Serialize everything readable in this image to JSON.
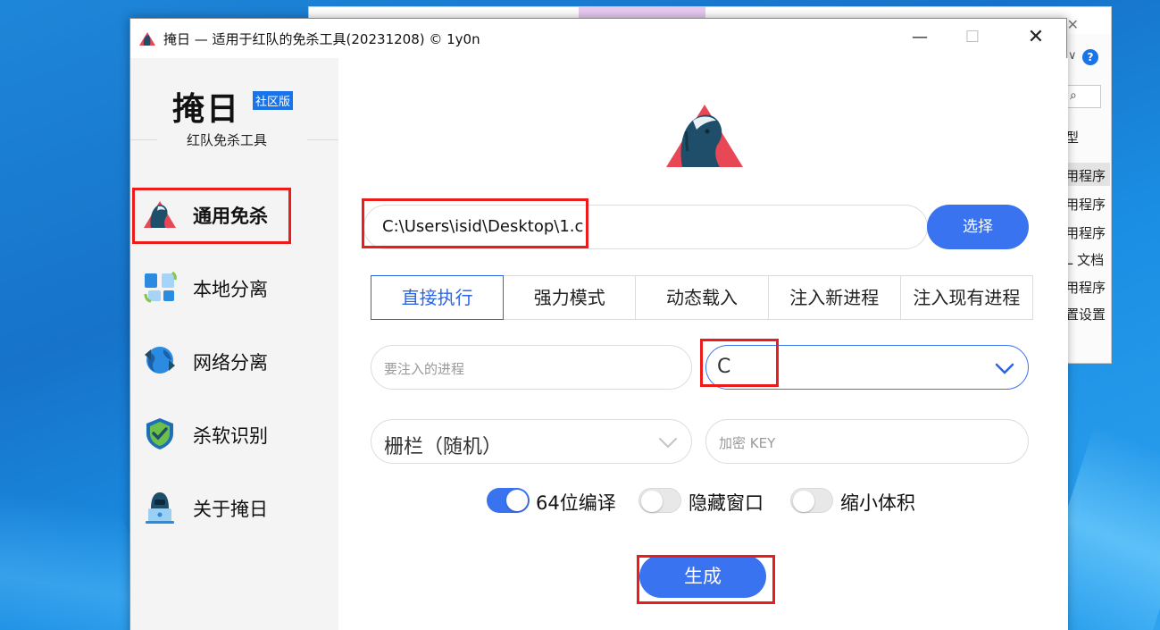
{
  "window": {
    "title": "掩日 — 适用于红队的免杀工具(20231208) © 1y0n",
    "minimize": "—",
    "maximize": "☐",
    "close": "✕"
  },
  "background_window": {
    "items": [
      "用程序",
      "用程序",
      "用程序",
      "L 文档",
      "用程序",
      "置设置"
    ],
    "header_fragment": "型",
    "close": "✕",
    "help": "?",
    "chevron": "∨",
    "search_icon": "⌕"
  },
  "sidebar": {
    "logo_title": "掩日",
    "logo_badge": "社区版",
    "logo_subtitle": "红队免杀工具",
    "items": [
      {
        "label": "通用免杀",
        "icon": "horse-icon",
        "active": true
      },
      {
        "label": "本地分离",
        "icon": "file-split-icon",
        "active": false
      },
      {
        "label": "网络分离",
        "icon": "globe-arrows-icon",
        "active": false
      },
      {
        "label": "杀软识别",
        "icon": "shield-check-icon",
        "active": false
      },
      {
        "label": "关于掩日",
        "icon": "hacker-laptop-icon",
        "active": false
      }
    ]
  },
  "main": {
    "file_path": "C:\\Users\\isid\\Desktop\\1.c",
    "select_button": "选择",
    "tabs": [
      {
        "label": "直接执行",
        "active": true
      },
      {
        "label": "强力模式",
        "active": false
      },
      {
        "label": "动态载入",
        "active": false
      },
      {
        "label": "注入新进程",
        "active": false
      },
      {
        "label": "注入现有进程",
        "active": false
      }
    ],
    "process_placeholder": "要注入的进程",
    "language_value": "C",
    "encoding_value": "栅栏（随机）",
    "key_placeholder": "加密 KEY",
    "toggles": [
      {
        "label": "64位编译",
        "on": true
      },
      {
        "label": "隐藏窗口",
        "on": false
      },
      {
        "label": "缩小体积",
        "on": false
      }
    ],
    "generate_button": "生成"
  },
  "colors": {
    "accent": "#3a73f0",
    "tab_active": "#2b64e8",
    "highlight_box": "#ee1b1b",
    "desktop": "#1673c9"
  }
}
